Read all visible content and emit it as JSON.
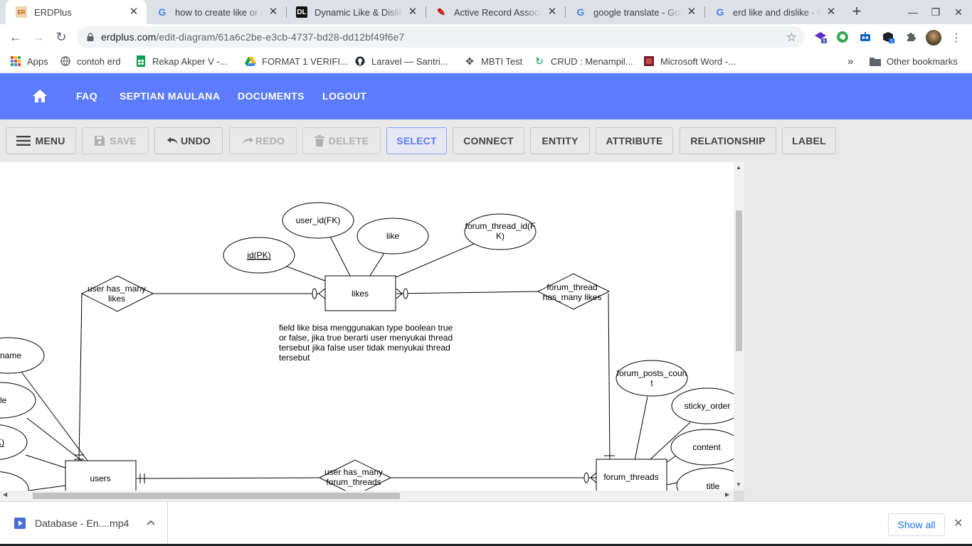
{
  "browser": {
    "tabs": [
      {
        "title": "ERDPlus",
        "favicon": "erdplus-icon",
        "favicon_text": "ER",
        "active": true
      },
      {
        "title": "how to create like or dislike",
        "favicon": "google-icon",
        "favicon_text": "G"
      },
      {
        "title": "Dynamic Like & Dislike",
        "favicon": "dev-icon",
        "favicon_text": "DL"
      },
      {
        "title": "Active Record Associations",
        "favicon": "rails-icon",
        "favicon_text": "✎"
      },
      {
        "title": "google translate - Google",
        "favicon": "google-icon",
        "favicon_text": "G"
      },
      {
        "title": "erd like and dislike - Google",
        "favicon": "google-icon",
        "favicon_text": "G"
      }
    ],
    "url_domain": "erdplus.com",
    "url_path": "/edit-diagram/61a6c2be-e3cb-4737-bd28-dd12bf49f6e7",
    "extension_badges": [
      "9",
      "1"
    ],
    "bookmarks": [
      {
        "label": "Apps",
        "icon": "apps-icon"
      },
      {
        "label": "contoh erd",
        "icon": "globe-icon"
      },
      {
        "label": "Rekap Akper V -...",
        "icon": "sheets-icon"
      },
      {
        "label": "FORMAT 1 VERIFI...",
        "icon": "drive-icon"
      },
      {
        "label": "Laravel — Santri...",
        "icon": "github-icon"
      },
      {
        "label": "MBTI Test",
        "icon": "move-icon"
      },
      {
        "label": "CRUD : Menampil...",
        "icon": "refresh-icon"
      },
      {
        "label": "Microsoft Word -...",
        "icon": "book-icon"
      }
    ],
    "bookmarks_more": "»",
    "other_bookmarks": "Other bookmarks"
  },
  "app": {
    "nav": [
      "FAQ",
      "SEPTIAN MAULANA",
      "DOCUMENTS",
      "LOGOUT"
    ],
    "tools": [
      {
        "label": "MENU",
        "disabled": false,
        "selected": false
      },
      {
        "label": "SAVE",
        "disabled": true,
        "selected": false
      },
      {
        "label": "UNDO",
        "disabled": false,
        "selected": false
      },
      {
        "label": "REDO",
        "disabled": true,
        "selected": false
      },
      {
        "label": "DELETE",
        "disabled": true,
        "selected": false
      },
      {
        "label": "SELECT",
        "disabled": false,
        "selected": true
      },
      {
        "label": "CONNECT",
        "disabled": false,
        "selected": false
      },
      {
        "label": "ENTITY",
        "disabled": false,
        "selected": false
      },
      {
        "label": "ATTRIBUTE",
        "disabled": false,
        "selected": false
      },
      {
        "label": "RELATIONSHIP",
        "disabled": false,
        "selected": false
      },
      {
        "label": "LABEL",
        "disabled": false,
        "selected": false
      }
    ]
  },
  "diagram": {
    "entities": {
      "likes": "likes",
      "users": "users",
      "forum_threads": "forum_threads"
    },
    "attributes": {
      "user_id_fk": "user_id(FK)",
      "like": "like",
      "forum_thread_id_fk_1": "forum_thread_id(F",
      "forum_thread_id_fk_2": "K)",
      "id_pk": "id(PK)",
      "name_partial": "name",
      "le_partial": "le",
      "k_partial": "K)",
      "forum_posts_count_1": "forum_posts_coun",
      "forum_posts_count_2": "t",
      "sticky_order": "sticky_order",
      "content": "content",
      "title": "title"
    },
    "relationships": {
      "user_likes_1": "user has_many",
      "user_likes_2": "likes",
      "thread_likes_1": "forum_thread",
      "thread_likes_2": "has_many likes",
      "user_threads_1": "user has_many",
      "user_threads_2": "forum_threads"
    },
    "note": [
      "field like bisa menggunakan type boolean true",
      "or false, jika true berarti user menyukai thread",
      "tersebut jika false user tidak menyukai thread",
      "tersebut"
    ]
  },
  "downloads": {
    "file": "Database - En....mp4",
    "show_all": "Show all"
  }
}
